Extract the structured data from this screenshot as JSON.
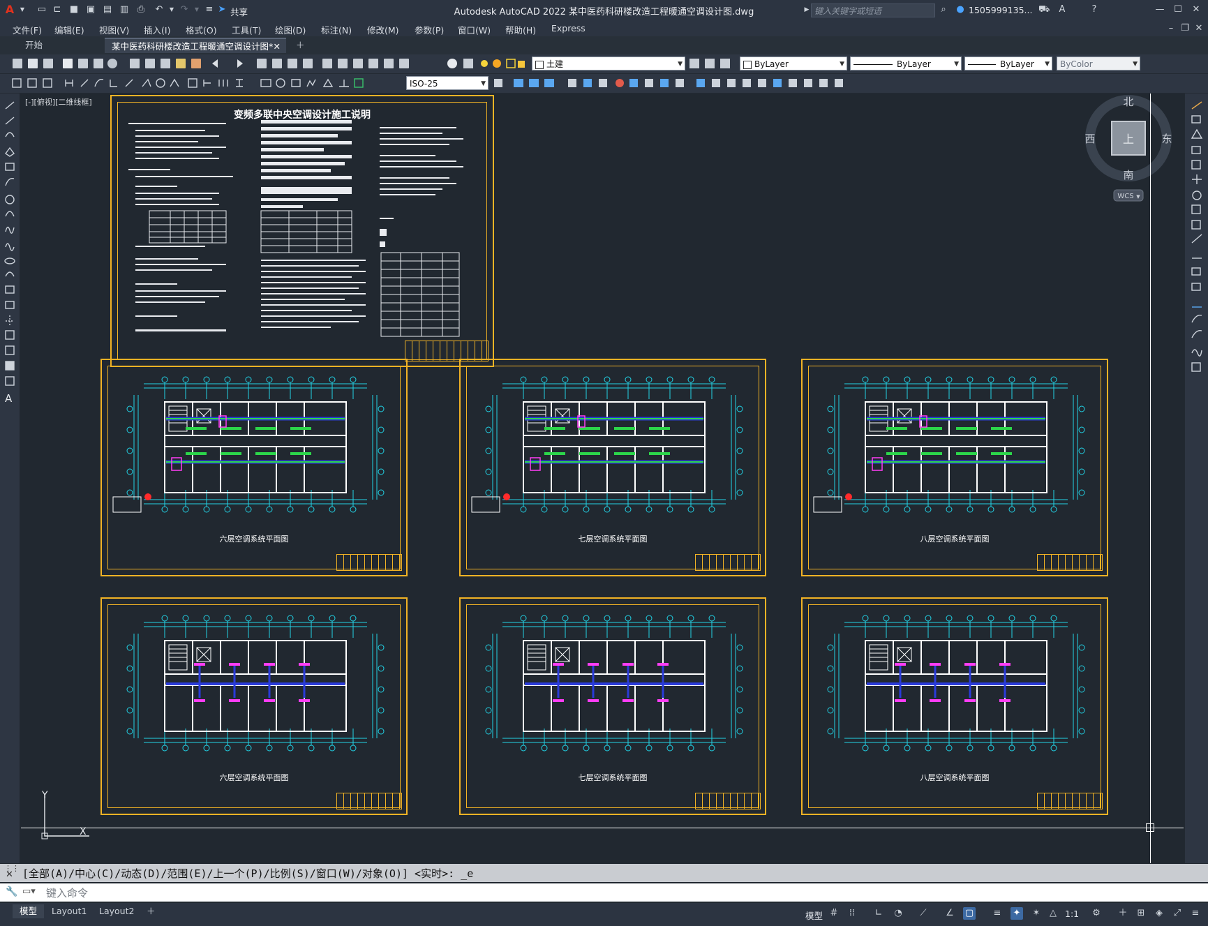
{
  "app": {
    "title": "Autodesk AutoCAD 2022    某中医药科研楼改造工程暖通空调设计图.dwg",
    "share_label": "共享",
    "search_placeholder": "键入关键字或短语",
    "user_name": "1505999135...",
    "accent_color": "#f2b325"
  },
  "menus": [
    "文件(F)",
    "编辑(E)",
    "视图(V)",
    "插入(I)",
    "格式(O)",
    "工具(T)",
    "绘图(D)",
    "标注(N)",
    "修改(M)",
    "参数(P)",
    "窗口(W)",
    "帮助(H)",
    "Express"
  ],
  "tabs": {
    "start": "开始",
    "document": "某中医药科研楼改造工程暖通空调设计图*"
  },
  "toolbar": {
    "layer": "土建",
    "color": "ByLayer",
    "linetype": "ByLayer",
    "lineweight": "ByLayer",
    "plotstyle": "ByColor",
    "dimstyle": "ISO-25"
  },
  "viewport": {
    "label": "[-][俯视][二维线框]",
    "viewcube": {
      "north": "北",
      "south": "南",
      "east": "东",
      "west": "西",
      "face": "上",
      "wcs": "WCS"
    },
    "ucs": {
      "x": "X",
      "y": "Y"
    }
  },
  "sheets": {
    "notes_title": "变频多联中央空调设计施工说明",
    "captions": [
      "六层空调系统平面图",
      "七层空调系统平面图",
      "八层空调系统平面图",
      "六层空调系统平面图",
      "七层空调系统平面图",
      "八层空调系统平面图"
    ]
  },
  "command": {
    "history": "[全部(A)/中心(C)/动态(D)/范围(E)/上一个(P)/比例(S)/窗口(W)/对象(O)] <实时>: _e",
    "placeholder": "键入命令"
  },
  "status": {
    "layouts": [
      "模型",
      "Layout1",
      "Layout2"
    ],
    "model_label": "模型",
    "scale": "1:1"
  }
}
